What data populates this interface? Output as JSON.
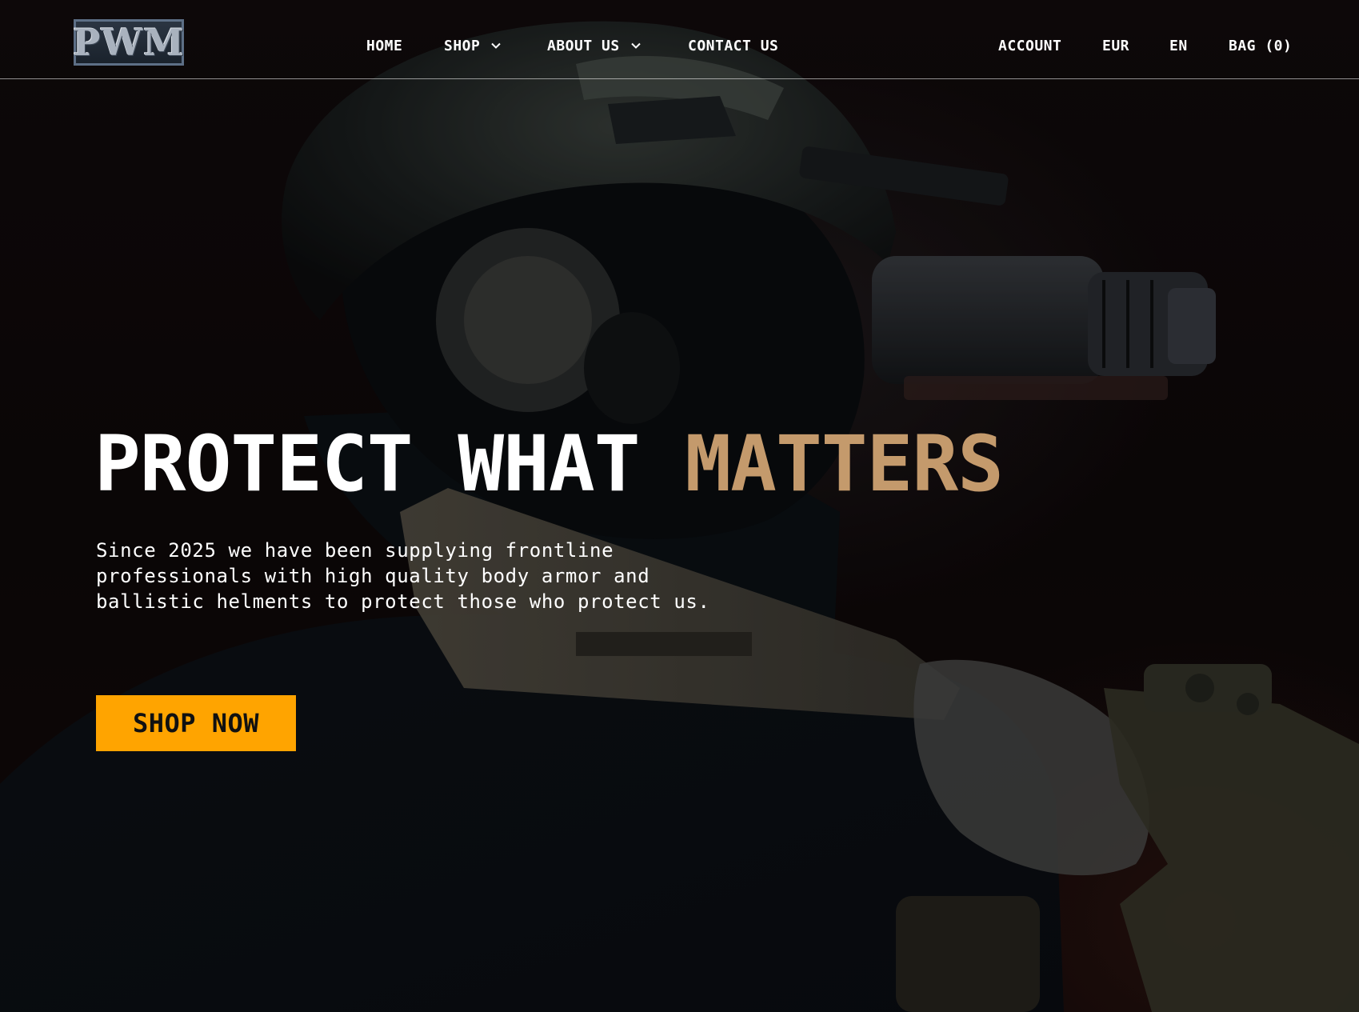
{
  "brand": {
    "logo_text": "PWM"
  },
  "nav": {
    "home": "HOME",
    "shop": "SHOP",
    "about": "ABOUT US",
    "contact": "CONTACT US",
    "account": "ACCOUNT",
    "currency": "EUR",
    "language": "EN",
    "bag": "BAG (0)"
  },
  "hero": {
    "title_main": "PROTECT WHAT",
    "title_accent": "MATTERS",
    "subtitle": "Since 2025 we have been supplying frontline professionals with high quality body armor and ballistic helments to protect those who protect us.",
    "cta_label": "SHOP NOW"
  },
  "colors": {
    "accent": "#c49a6c",
    "cta": "#ffa400",
    "background": "#0e0809",
    "text": "#ffffff"
  },
  "icons": {
    "shop_dropdown": "chevron-down-icon",
    "about_dropdown": "chevron-down-icon"
  }
}
